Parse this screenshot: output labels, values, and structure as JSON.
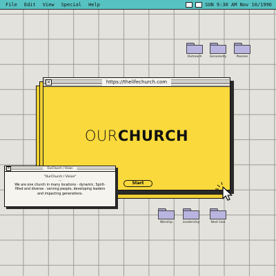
{
  "menubar": {
    "items": [
      "File",
      "Edit",
      "View",
      "Special",
      "Help"
    ],
    "clock": "SUN 9:30 AM Nov 10/1996"
  },
  "desktop_folders_top": [
    {
      "label": "Outreach"
    },
    {
      "label": "Generosity"
    },
    {
      "label": "Passion"
    }
  ],
  "desktop_folders_bottom": [
    {
      "label": "Worship"
    },
    {
      "label": "Leadership"
    },
    {
      "label": "Next Gen"
    }
  ],
  "main_window": {
    "url": "https://thelifechurch.com",
    "brand_light": "OUR",
    "brand_bold": "CHURCH",
    "start_label": "Start"
  },
  "vision_window": {
    "title": "OurChurch / Vision",
    "heading": "\"OurChurch / Vision\"",
    "dots": "...",
    "body": "We are one church in many locations - dynamic, Spirit-filled and diverse - serving people, developing leaders and impacting generations."
  },
  "colors": {
    "menubar": "#57c2c2",
    "window_yellow": "#f9d93b",
    "folder": "#b9b5e0",
    "desktop": "#e4e2dc"
  }
}
